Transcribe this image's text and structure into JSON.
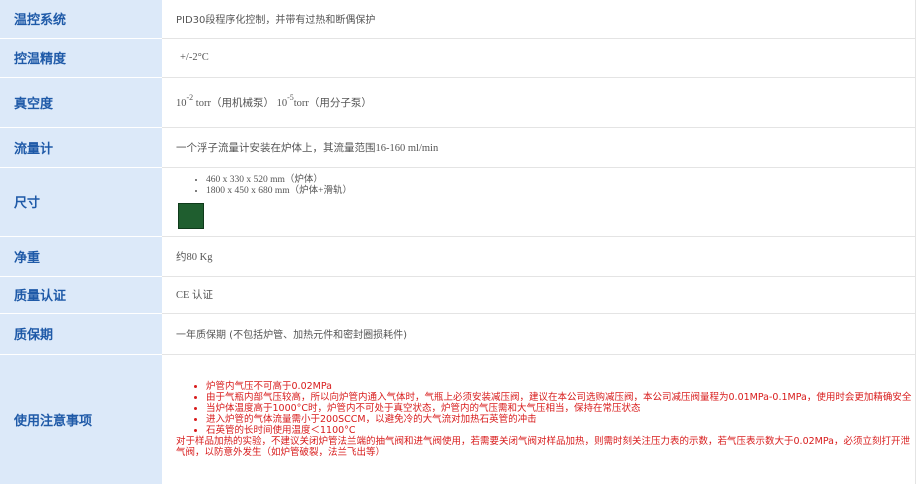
{
  "rows": {
    "temp_system": {
      "label": "温控系统",
      "value": "PID30段程序化控制，并带有过热和断偶保护"
    },
    "temp_accuracy": {
      "label": "控温精度",
      "value": "+/-2°C"
    },
    "vacuum": {
      "label": "真空度",
      "base1": "10",
      "exp1": "-2",
      "unit1": "torr（用机械泵）",
      "base2": "10",
      "exp2": "-5",
      "unit2": "torr（用分子泵）"
    },
    "flowmeter": {
      "label": "流量计",
      "value": "一个浮子流量计安装在炉体上，其流量范围16-160 ml/min"
    },
    "size": {
      "label": "尺寸",
      "items": [
        "460 x 330 x 520  mm（炉体）",
        "1800 x 450 x 680 mm（炉体+滑轨）"
      ],
      "swatch_color": "#1f5e2f"
    },
    "net_weight": {
      "label": "净重",
      "value": "约80 Kg"
    },
    "certification": {
      "label": "质量认证",
      "value": "CE 认证"
    },
    "warranty": {
      "label": "质保期",
      "value": "一年质保期 (不包括炉管、加热元件和密封圈损耗件)"
    },
    "notes": {
      "label": "使用注意事项",
      "color": "#d81c1c",
      "items": [
        "炉管内气压不可高于0.02MPa",
        "由于气瓶内部气压较高，所以向炉管内通入气体时，气瓶上必须安装减压阀，建议在本公司选购减压阀，本公司减压阀量程为0.01MPa-0.1MPa，使用时会更加精确安全",
        "当炉体温度高于1000°C时，炉管内不可处于真空状态，炉管内的气压需和大气压相当，保持在常压状态",
        "进入炉管的气体流量需小于200SCCM，以避免冷的大气流对加热石英管的冲击",
        "石英管的长时间使用温度＜1100°C"
      ],
      "tail": "对于样品加热的实验，不建议关闭炉管法兰端的抽气阀和进气阀使用，若需要关闭气阀对样品加热，则需时刻关注压力表的示数，若气压表示数大于0.02MPa，必须立刻打开泄气阀，以防意外发生（如炉管破裂，法兰飞出等）"
    }
  }
}
